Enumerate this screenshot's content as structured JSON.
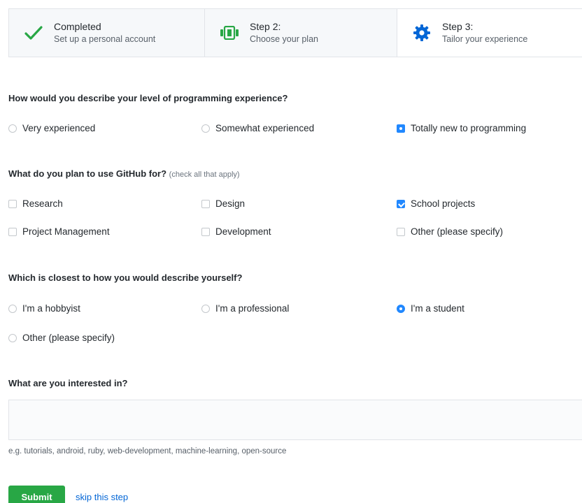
{
  "steps": [
    {
      "title": "Completed",
      "subtitle": "Set up a personal account",
      "icon": "check-icon"
    },
    {
      "title": "Step 2:",
      "subtitle": "Choose your plan",
      "icon": "plan-card-icon"
    },
    {
      "title": "Step 3:",
      "subtitle": "Tailor your experience",
      "icon": "gear-icon"
    }
  ],
  "q1": {
    "label": "How would you describe your level of programming experience?",
    "options": [
      "Very experienced",
      "Somewhat experienced",
      "Totally new to programming"
    ],
    "selected": "Totally new to programming"
  },
  "q2": {
    "label": "What do you plan to use GitHub for?",
    "note": "(check all that apply)",
    "options": [
      "Research",
      "Design",
      "School projects",
      "Project Management",
      "Development",
      "Other (please specify)"
    ],
    "checked": [
      "School projects"
    ]
  },
  "q3": {
    "label": "Which is closest to how you would describe yourself?",
    "options": [
      "I'm a hobbyist",
      "I'm a professional",
      "I'm a student",
      "Other (please specify)"
    ],
    "selected": "I'm a student"
  },
  "q4": {
    "label": "What are you interested in?",
    "input_value": "",
    "hint": "e.g. tutorials, android, ruby, web-development, machine-learning, open-source"
  },
  "actions": {
    "submit_label": "Submit",
    "skip_label": "skip this step"
  },
  "colors": {
    "accent": "#2188ff",
    "success": "#28a745",
    "link": "#0366d6",
    "check": "#28a745",
    "gear": "#0366d6"
  }
}
